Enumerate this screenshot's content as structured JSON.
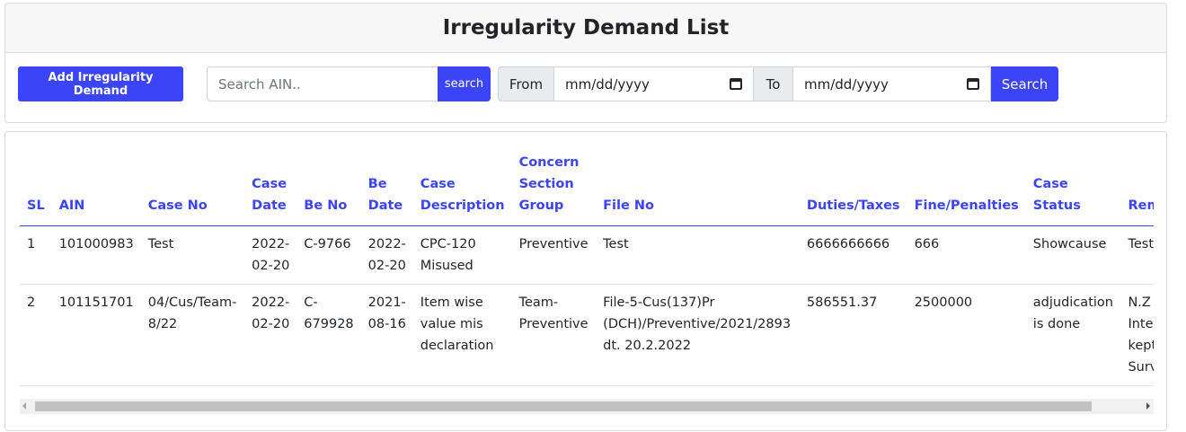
{
  "header": {
    "title": "Irregularity Demand List"
  },
  "toolbar": {
    "add_label": "Add Irregularity Demand",
    "search_placeholder": "Search AIN..",
    "search_small_label": "search",
    "from_label": "From",
    "to_label": "To",
    "from_date": "mm/dd/yyyy",
    "to_date": "mm/dd/yyyy",
    "search_label": "Search"
  },
  "table": {
    "columns": [
      "SL",
      "AIN",
      "Case No",
      "Case Date",
      "Be No",
      "Be Date",
      "Case Description",
      "Concern Section Group",
      "File No",
      "Duties/Taxes",
      "Fine/Penalties",
      "Case Status",
      "Remar"
    ],
    "rows": [
      [
        "1",
        "101000983",
        "Test",
        "2022-02-20",
        "C-9766",
        "2022-02-20",
        "CPC-120 Misused",
        "Preventive",
        "Test",
        "6666666666",
        "666",
        "Showcause",
        "Test"
      ],
      [
        "2",
        "101151701",
        "04/Cus/Team-8/22",
        "2022-02-20",
        "C-679928",
        "2021-08-16",
        "Item wise value mis declaration",
        "Team-Preventive",
        "File-5-Cus(137)Pr (DCH)/Preventive/2021/2893 dt. 20.2.2022",
        "586551.37",
        "2500000",
        "adjudication is done",
        "N.Z Interna kept ir Surveil"
      ]
    ]
  },
  "colors": {
    "accent": "#3b44f6",
    "header_bg": "#f7f7f7"
  }
}
